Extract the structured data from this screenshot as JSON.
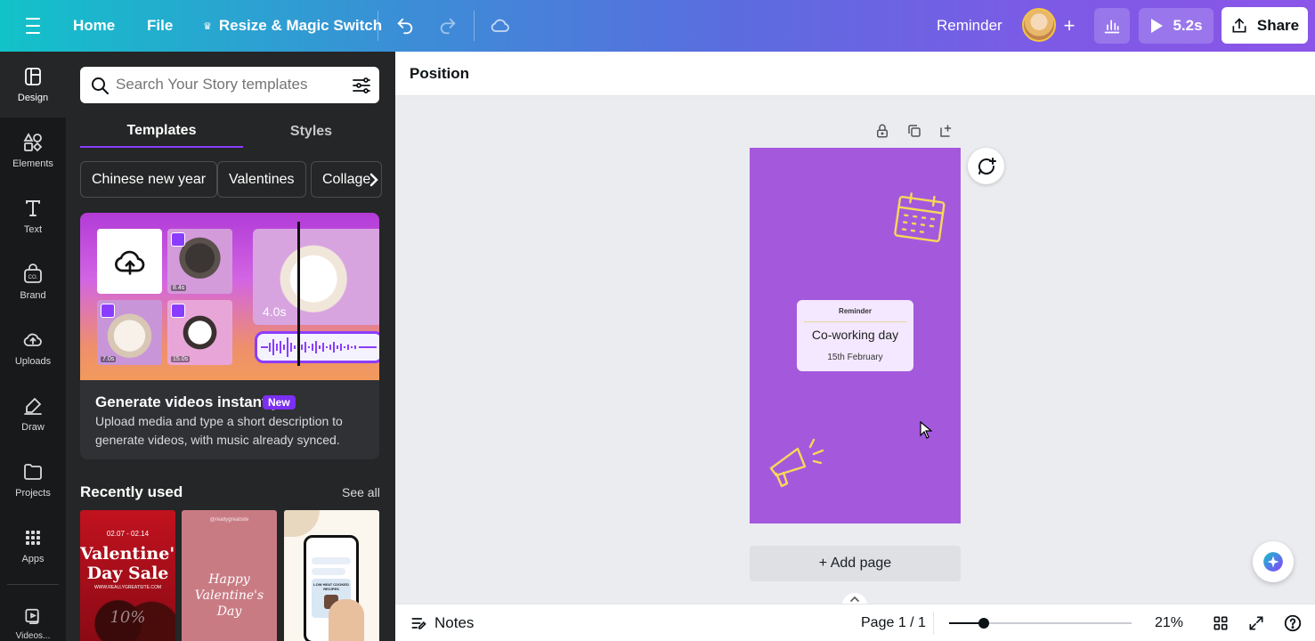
{
  "topbar": {
    "home_label": "Home",
    "file_label": "File",
    "resize_label": "Resize & Magic Switch",
    "doc_title": "Reminder",
    "play_duration": "5.2s",
    "share_label": "Share"
  },
  "rail": {
    "items": [
      {
        "label": "Design",
        "icon": "design-icon"
      },
      {
        "label": "Elements",
        "icon": "elements-icon"
      },
      {
        "label": "Text",
        "icon": "text-icon"
      },
      {
        "label": "Brand",
        "icon": "brand-icon"
      },
      {
        "label": "Uploads",
        "icon": "uploads-icon"
      },
      {
        "label": "Draw",
        "icon": "draw-icon"
      },
      {
        "label": "Projects",
        "icon": "projects-icon"
      },
      {
        "label": "Apps",
        "icon": "apps-icon"
      }
    ],
    "bottom_label": "Videos..."
  },
  "panel": {
    "search_placeholder": "Search Your Story templates",
    "tabs": [
      "Templates",
      "Styles"
    ],
    "active_tab": "Templates",
    "chips": [
      "Chinese new year",
      "Valentines",
      "Collage"
    ],
    "promo": {
      "title": "Generate videos instantly",
      "badge": "New",
      "description": "Upload media and type a short description to generate videos, with music already synced.",
      "durations": [
        "8.4s",
        "7.0s",
        "15.0s",
        "4.0s"
      ]
    },
    "recent_title": "Recently used",
    "see_all": "See all",
    "thumbnails": [
      {
        "date": "02.07 - 02.14",
        "title_line1": "Valentine's",
        "title_line2": "Day Sale",
        "site": "WWW.REALLYGREATSITE.COM",
        "badge": "10%"
      },
      {
        "handle": "@reallygreatsite",
        "title_line1": "Happy",
        "title_line2": "Valentine's",
        "title_line3": "Day"
      },
      {
        "label": "LOW HEAT COOKED RECIPES"
      }
    ]
  },
  "editor": {
    "toolbar_label": "Position",
    "card": {
      "title": "Reminder",
      "main": "Co-working day",
      "date": "15th February"
    },
    "add_page_label": "+ Add page"
  },
  "bottombar": {
    "notes_label": "Notes",
    "page_count": "Page 1 / 1",
    "zoom": "21%",
    "zoom_level": 0.21
  },
  "colors": {
    "canvas_page": "#a459dd",
    "accent": "#8b3dff",
    "rail_bg": "#18191b",
    "panel_bg": "#252627"
  }
}
